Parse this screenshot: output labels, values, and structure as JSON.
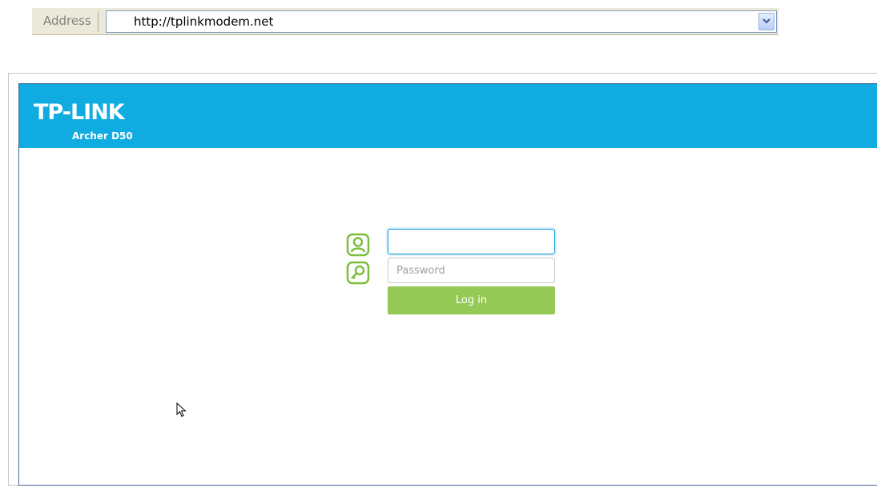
{
  "address_bar": {
    "label": "Address",
    "url": "http://tplinkmodem.net"
  },
  "header": {
    "brand": "TP-LINK",
    "model": "Archer D50",
    "background_color": "#10abe1"
  },
  "login": {
    "username": {
      "value": "",
      "placeholder": "",
      "icon": "user-icon"
    },
    "password": {
      "value": "",
      "placeholder": "Password",
      "icon": "key-icon"
    },
    "button_label": "Log in",
    "button_color": "#94c955",
    "icon_color": "#7ebd3d"
  },
  "cursor": {
    "icon": "mouse-pointer-icon"
  }
}
